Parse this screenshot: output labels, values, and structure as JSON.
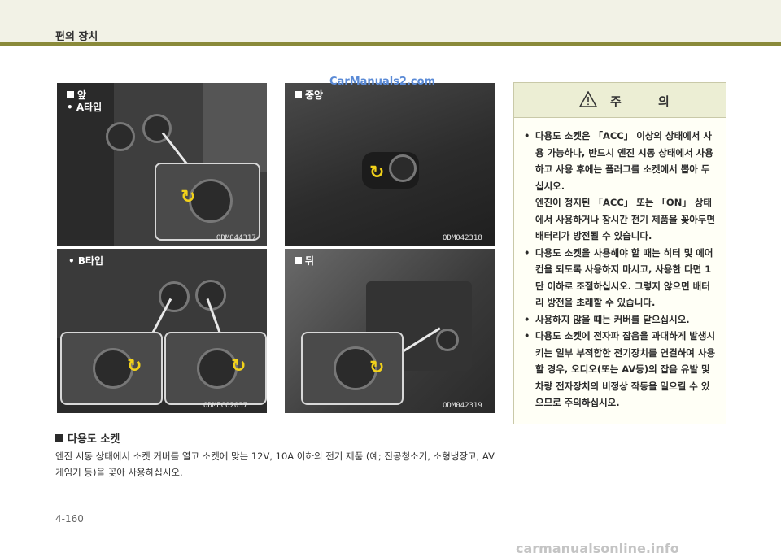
{
  "header": {
    "title": "편의 장치"
  },
  "watermark": "CarManuals2.com",
  "photos": {
    "front": {
      "label1": "앞",
      "label2": "A타입",
      "code": "ODM044317"
    },
    "center": {
      "label1": "중앙",
      "code": "ODM042318"
    },
    "btype": {
      "label1": "B타입",
      "code": "ODMECO2037"
    },
    "rear": {
      "label1": "뒤",
      "code": "ODM042319"
    }
  },
  "caution": {
    "title": "주 의",
    "items": [
      "다용도 소켓은 「ACC」 이상의 상태에서 사용 가능하나, 반드시 엔진 시동 상태에서 사용하고 사용 후에는 플러그를 소켓에서 뽑아 두십시오.",
      "엔진이 정지된 「ACC」 또는 「ON」 상태에서 사용하거나 장시간 전기 제품을 꽂아두면 배터리가 방전될 수 있습니다.",
      "다용도 소켓을 사용해야 할 때는 히터 및 에어컨을 되도록 사용하지 마시고, 사용한 다면 1단 이하로 조절하십시오. 그렇지 않으면 배터리 방전을 초래할 수 있습니다.",
      "사용하지 않을 때는 커버를 닫으십시오.",
      "다용도 소켓에 전자파 잡음을 과대하게 발생시키는 일부 부적합한 전기장치를 연결하여 사용할 경우, 오디오(또는 AV등)의 잡음 유발 및 차량 전자장치의 비정상 작동을 일으킬 수 있으므로 주의하십시오."
    ]
  },
  "section": {
    "title": "다용도 소켓",
    "body": "엔진 시동 상태에서 소켓 커버를 열고 소켓에 맞는 12V, 10A 이하의 전기 제품 (예; 진공청소기, 소형냉장고, AV게임기 등)을 꽂아 사용하십시오."
  },
  "page_number": "4-160",
  "footer_watermark": "carmanualsonline.info"
}
